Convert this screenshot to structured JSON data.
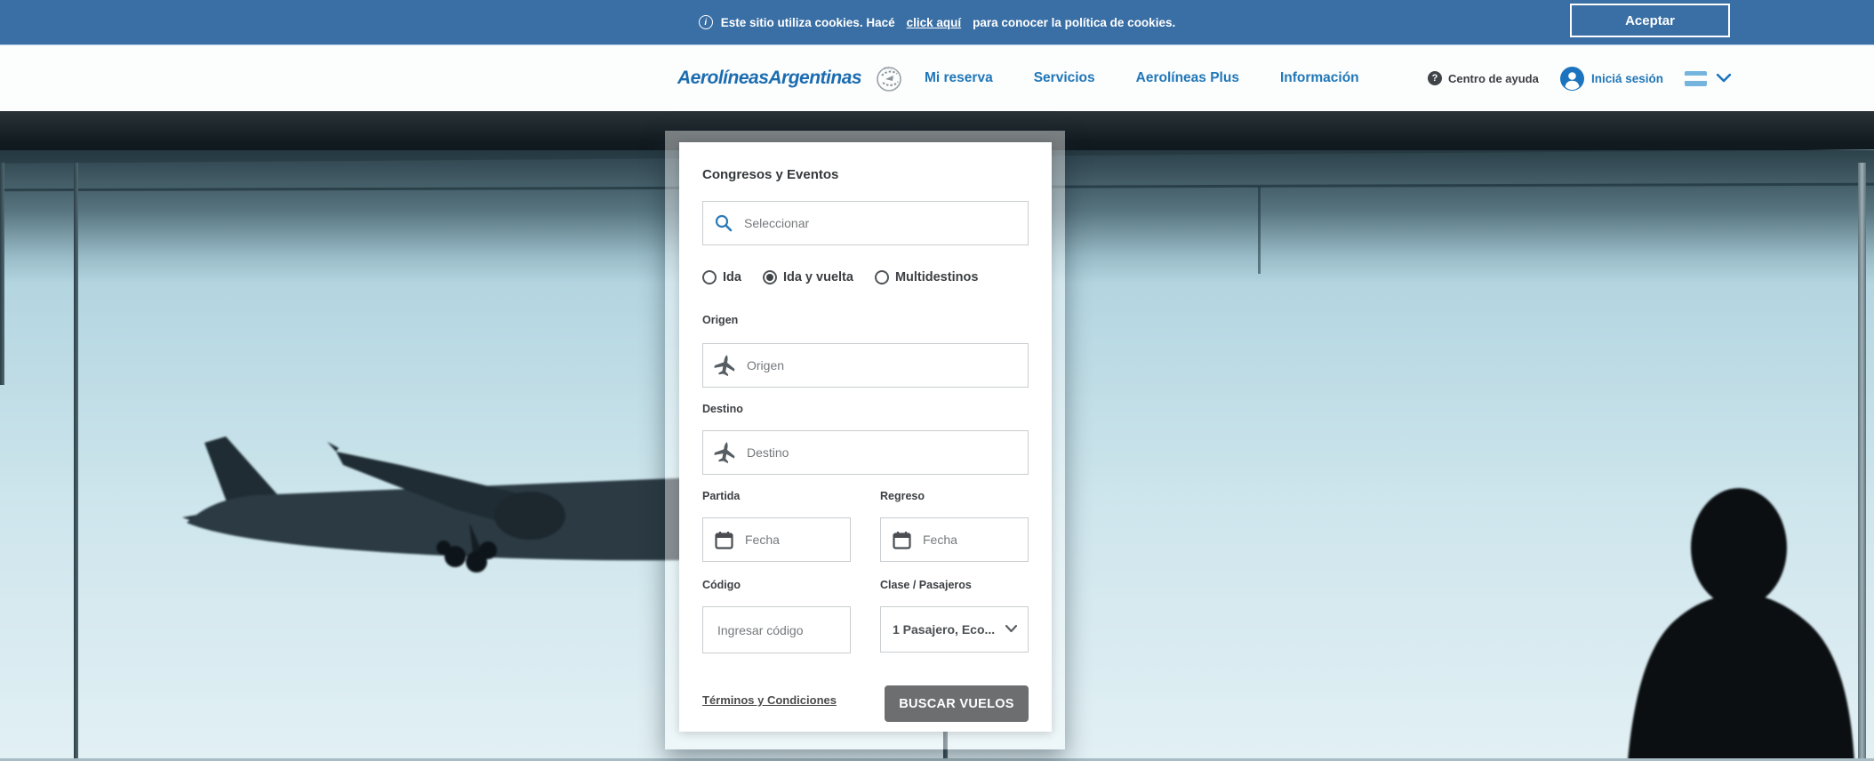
{
  "cookie_banner": {
    "text_before": "Este sitio utiliza cookies. Hacé",
    "link_text": "click aquí",
    "text_after": "para conocer la política de cookies.",
    "accept_label": "Aceptar"
  },
  "navbar": {
    "logo_text": "AerolíneasArgentinas",
    "items": [
      {
        "label": "Mi reserva"
      },
      {
        "label": "Servicios"
      },
      {
        "label": "Aerolíneas Plus"
      },
      {
        "label": "Información"
      }
    ],
    "help_label": "Centro de ayuda",
    "login_label": "Iniciá sesión"
  },
  "booking_form": {
    "category_label": "Congresos y Eventos",
    "search_placeholder": "Seleccionar",
    "trip_types": [
      {
        "label": "Ida",
        "selected": false
      },
      {
        "label": "Ida y vuelta",
        "selected": true
      },
      {
        "label": "Multidestinos",
        "selected": false
      }
    ],
    "origin_label": "Origen",
    "origin_placeholder": "Origen",
    "destination_label": "Destino",
    "destination_placeholder": "Destino",
    "departure_label": "Partida",
    "return_label": "Regreso",
    "date_placeholder": "Fecha",
    "code_label": "Código",
    "code_placeholder": "Ingresar código",
    "class_label": "Clase / Pasajeros",
    "class_value": "1 Pasajero, Eco...",
    "terms_label": "Términos y Condiciones",
    "search_button_label": "BUSCAR VUELOS"
  },
  "icons": {
    "info": "circle-i",
    "search": "magnifier",
    "plane": "airplane-up",
    "calendar": "calendar-outline",
    "chevron": "chevron-down",
    "help": "question-circle",
    "user": "person-circle",
    "flag": "argentina-flag",
    "skyteam": "skyteam-badge",
    "condor": "condor-swoosh"
  },
  "colors": {
    "banner_blue": "#3a6fa5",
    "brand_blue": "#2077b8",
    "button_gray": "#6c6e70",
    "sky_light": "#cfe6ed",
    "ceiling_dark": "#121b20"
  }
}
